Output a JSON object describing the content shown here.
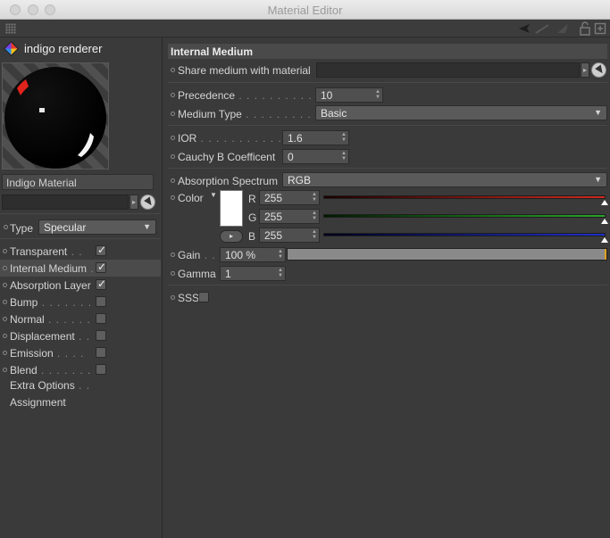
{
  "window": {
    "title": "Material Editor"
  },
  "left": {
    "renderer_name": "indigo renderer",
    "material_name": "Indigo Material",
    "type_label": "Type",
    "type_value": "Specular",
    "channels": [
      {
        "label": "Transparent",
        "checked": true,
        "active": false
      },
      {
        "label": "Internal Medium",
        "checked": true,
        "active": true
      },
      {
        "label": "Absorption Layer",
        "checked": true,
        "active": false
      },
      {
        "label": "Bump",
        "checked": false,
        "active": false
      },
      {
        "label": "Normal",
        "checked": false,
        "active": false
      },
      {
        "label": "Displacement",
        "checked": false,
        "active": false
      },
      {
        "label": "Emission",
        "checked": false,
        "active": false
      },
      {
        "label": "Blend",
        "checked": false,
        "active": false
      }
    ],
    "extra_options": "Extra Options",
    "assignment": "Assignment"
  },
  "right": {
    "section_title": "Internal Medium",
    "share_medium_label": "Share medium with material",
    "precedence_label": "Precedence",
    "precedence_value": "10",
    "medium_type_label": "Medium Type",
    "medium_type_value": "Basic",
    "ior_label": "IOR",
    "ior_value": "1.6",
    "cauchy_label": "Cauchy B Coefficent",
    "cauchy_value": "0",
    "absorption_label": "Absorption Spectrum",
    "absorption_value": "RGB",
    "color_label": "Color",
    "color": {
      "r_label": "R",
      "r_value": "255",
      "g_label": "G",
      "g_value": "255",
      "b_label": "B",
      "b_value": "255",
      "swatch": "#ffffff"
    },
    "gain_label": "Gain",
    "gain_value": "100 %",
    "gain_fraction": 1.0,
    "gamma_label": "Gamma",
    "gamma_value": "1",
    "sss_label": "SSS",
    "sss_checked": false
  },
  "colors": {
    "panel_bg": "#3a3a3a",
    "red_slider": "#d02a1e",
    "green_slider": "#2aa62a",
    "blue_slider": "#1f2fc8"
  }
}
